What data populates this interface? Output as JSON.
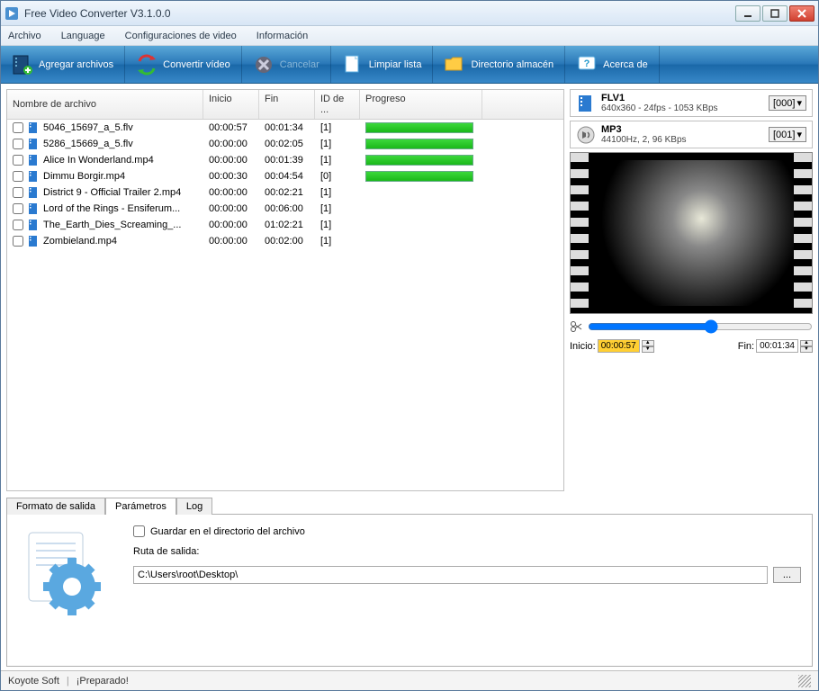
{
  "window": {
    "title": "Free Video Converter V3.1.0.0"
  },
  "menu": {
    "file": "Archivo",
    "language": "Language",
    "videoconfig": "Configuraciones de video",
    "info": "Información"
  },
  "toolbar": {
    "add": "Agregar archivos",
    "convert": "Convertir vídeo",
    "cancel": "Cancelar",
    "clear": "Limpiar lista",
    "outdir": "Directorio almacén",
    "about": "Acerca de"
  },
  "table": {
    "headers": {
      "name": "Nombre de archivo",
      "start": "Inicio",
      "end": "Fin",
      "id": "ID de ...",
      "progress": "Progreso"
    },
    "rows": [
      {
        "name": "5046_15697_a_5.flv",
        "start": "00:00:57",
        "end": "00:01:34",
        "id": "[1]",
        "progress": 100
      },
      {
        "name": "5286_15669_a_5.flv",
        "start": "00:00:00",
        "end": "00:02:05",
        "id": "[1]",
        "progress": 100
      },
      {
        "name": "Alice In Wonderland.mp4",
        "start": "00:00:00",
        "end": "00:01:39",
        "id": "[1]",
        "progress": 100
      },
      {
        "name": "Dimmu Borgir.mp4",
        "start": "00:00:30",
        "end": "00:04:54",
        "id": "[0]",
        "progress": 100
      },
      {
        "name": "District 9 - Official Trailer 2.mp4",
        "start": "00:00:00",
        "end": "00:02:21",
        "id": "[1]",
        "progress": 0
      },
      {
        "name": "Lord of the Rings - Ensiferum...",
        "start": "00:00:00",
        "end": "00:06:00",
        "id": "[1]",
        "progress": 0
      },
      {
        "name": "The_Earth_Dies_Screaming_...",
        "start": "00:00:00",
        "end": "01:02:21",
        "id": "[1]",
        "progress": 0
      },
      {
        "name": "Zombieland.mp4",
        "start": "00:00:00",
        "end": "00:02:00",
        "id": "[1]",
        "progress": 0
      }
    ]
  },
  "formats": {
    "video": {
      "title": "FLV1",
      "sub": "640x360 - 24fps - 1053 KBps",
      "sel": "[000]"
    },
    "audio": {
      "title": "MP3",
      "sub": "44100Hz, 2, 96 KBps",
      "sel": "[001]"
    }
  },
  "trim": {
    "start_label": "Inicio:",
    "start_val": "00:00:57",
    "end_label": "Fin:",
    "end_val": "00:01:34"
  },
  "tabs": {
    "output": "Formato de salida",
    "params": "Parámetros",
    "log": "Log"
  },
  "params": {
    "save_in_dir": "Guardar en el directorio del archivo",
    "path_label": "Ruta de salida:",
    "path_value": "C:\\Users\\root\\Desktop\\",
    "browse": "..."
  },
  "status": {
    "company": "Koyote Soft",
    "msg": "¡Preparado!"
  }
}
